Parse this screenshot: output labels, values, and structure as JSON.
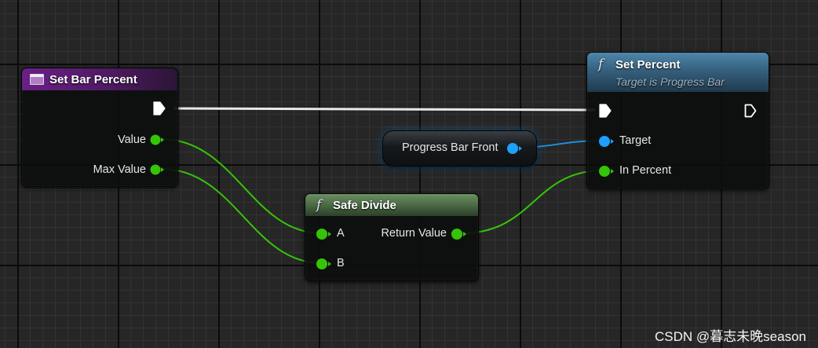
{
  "nodes": {
    "event": {
      "title": "Set Bar Percent",
      "header_color": "#5d1f73",
      "icon": "event-node-icon",
      "pins": {
        "value": "Value",
        "max_value": "Max Value"
      }
    },
    "set_percent": {
      "title": "Set Percent",
      "subtitle": "Target is Progress Bar",
      "header_color": "#35607e",
      "icon": "function-icon",
      "pins": {
        "target": "Target",
        "in_percent": "In Percent"
      }
    },
    "progress_bar_front": {
      "label": "Progress Bar Front",
      "pin_color": "#1ea0ff"
    },
    "safe_divide": {
      "title": "Safe Divide",
      "header_color": "#4b6a45",
      "icon": "function-icon",
      "pins": {
        "a": "A",
        "b": "B",
        "return_value": "Return Value"
      }
    }
  },
  "colors": {
    "float_pin": "#35c408",
    "object_pin": "#1ea0ff",
    "exec_wire": "#ffffff"
  },
  "watermark": "CSDN @暮志未晚season"
}
